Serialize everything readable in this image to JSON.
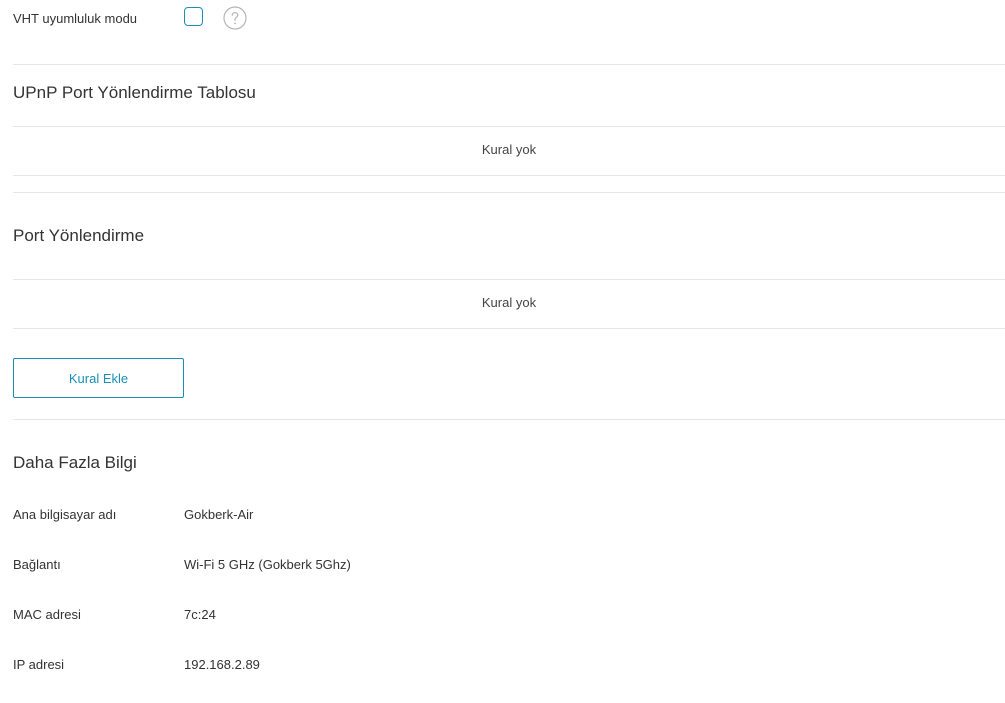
{
  "vht": {
    "label": "VHT uyumluluk modu",
    "checked": false,
    "help_icon": "question-circle-icon"
  },
  "upnp": {
    "title": "UPnP Port Yönlendirme Tablosu",
    "empty_text": "Kural yok"
  },
  "port_forwarding": {
    "title": "Port Yönlendirme",
    "empty_text": "Kural yok",
    "add_button_label": "Kural Ekle"
  },
  "more_info": {
    "title": "Daha Fazla Bilgi",
    "rows": [
      {
        "label": "Ana bilgisayar adı",
        "value": "Gokberk-Air"
      },
      {
        "label": "Bağlantı",
        "value": "Wi-Fi 5 GHz (Gokberk 5Ghz)"
      },
      {
        "label": "MAC adresi",
        "value": "7c:2⁠4"
      },
      {
        "label": "IP adresi",
        "value": "192.168.2.89"
      }
    ]
  },
  "colors": {
    "accent": "#1a8fb5",
    "divider": "#e6e6e6",
    "text": "#333333"
  }
}
